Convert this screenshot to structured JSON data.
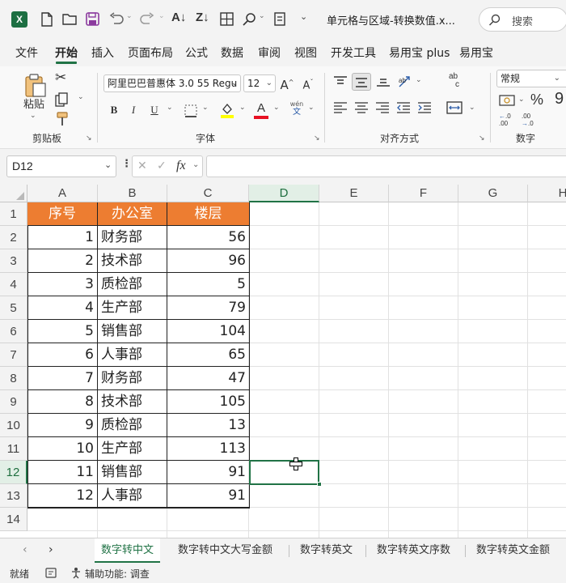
{
  "title_bar": {
    "document_title": "单元格与区域-转换数值.x...",
    "search_placeholder": "搜索"
  },
  "menu_tabs": [
    "文件",
    "开始",
    "插入",
    "页面布局",
    "公式",
    "数据",
    "审阅",
    "视图",
    "开发工具",
    "易用宝 plus",
    "易用宝"
  ],
  "ribbon": {
    "clipboard": {
      "paste_label": "粘贴",
      "group_label": "剪贴板"
    },
    "font": {
      "font_name": "阿里巴巴普惠体 3.0 55 Regu",
      "font_size": "12",
      "group_label": "字体",
      "bold": "B",
      "italic": "I",
      "underline": "U",
      "phonetic_top": "wén",
      "phonetic_bottom": "文",
      "increase_font": "A",
      "decrease_font": "A"
    },
    "alignment": {
      "group_label": "对齐方式",
      "wrap_top": "ab",
      "wrap_bottom": "c"
    },
    "number": {
      "format": "常规",
      "group_label": "数字"
    }
  },
  "formula_bar": {
    "name_box": "D12",
    "fx": "fx",
    "value": ""
  },
  "columns": [
    "A",
    "B",
    "C",
    "D",
    "E",
    "F",
    "G",
    "H"
  ],
  "selected_cell": "D12",
  "rows": [
    "1",
    "2",
    "3",
    "4",
    "5",
    "6",
    "7",
    "8",
    "9",
    "10",
    "11",
    "12",
    "13",
    "14"
  ],
  "table": {
    "headers": [
      "序号",
      "办公室",
      "楼层"
    ],
    "header_color": "#ed7d31",
    "data": [
      [
        "1",
        "财务部",
        "56"
      ],
      [
        "2",
        "技术部",
        "96"
      ],
      [
        "3",
        "质检部",
        "5"
      ],
      [
        "4",
        "生产部",
        "79"
      ],
      [
        "5",
        "销售部",
        "104"
      ],
      [
        "6",
        "人事部",
        "65"
      ],
      [
        "7",
        "财务部",
        "47"
      ],
      [
        "8",
        "技术部",
        "105"
      ],
      [
        "9",
        "质检部",
        "13"
      ],
      [
        "10",
        "生产部",
        "113"
      ],
      [
        "11",
        "销售部",
        "91"
      ],
      [
        "12",
        "人事部",
        "91"
      ]
    ]
  },
  "sheet_tabs": [
    "数字转中文",
    "数字转中文大写金额",
    "数字转英文",
    "数字转英文序数",
    "数字转英文金额"
  ],
  "active_sheet": "数字转中文",
  "status_bar": {
    "ready": "就绪",
    "accessibility": "辅助功能: 调查"
  },
  "accent_color": "#217346"
}
